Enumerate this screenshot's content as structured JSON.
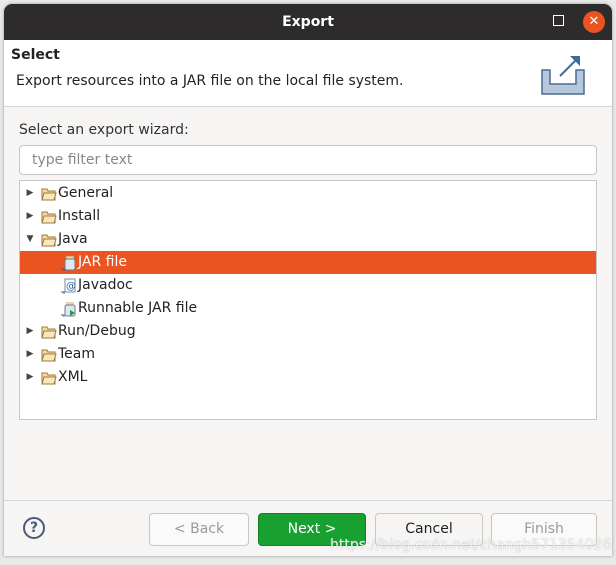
{
  "window": {
    "title": "Export"
  },
  "header": {
    "title": "Select",
    "description": "Export resources into a JAR file on the local file system."
  },
  "wizard": {
    "label": "Select an export wizard:",
    "filter_placeholder": "type filter text"
  },
  "tree": [
    {
      "label": "General",
      "level": 0,
      "expanded": false,
      "icon": "folder-icon"
    },
    {
      "label": "Install",
      "level": 0,
      "expanded": false,
      "icon": "folder-icon"
    },
    {
      "label": "Java",
      "level": 0,
      "expanded": true,
      "icon": "folder-icon"
    },
    {
      "label": "JAR file",
      "level": 1,
      "selected": true,
      "icon": "jar-icon"
    },
    {
      "label": "Javadoc",
      "level": 1,
      "icon": "javadoc-icon"
    },
    {
      "label": "Runnable JAR file",
      "level": 1,
      "icon": "runnable-jar-icon"
    },
    {
      "label": "Run/Debug",
      "level": 0,
      "expanded": false,
      "icon": "folder-icon"
    },
    {
      "label": "Team",
      "level": 0,
      "expanded": false,
      "icon": "folder-icon"
    },
    {
      "label": "XML",
      "level": 0,
      "expanded": false,
      "icon": "folder-icon"
    }
  ],
  "buttons": {
    "back": "< Back",
    "next": "Next >",
    "cancel": "Cancel",
    "finish": "Finish",
    "help": "?"
  },
  "watermark": "https://blog.csdn.net/zhangh571354026",
  "colors": {
    "selection": "#e95420",
    "primary": "#18a030",
    "titlebar": "#2d2b2b"
  }
}
